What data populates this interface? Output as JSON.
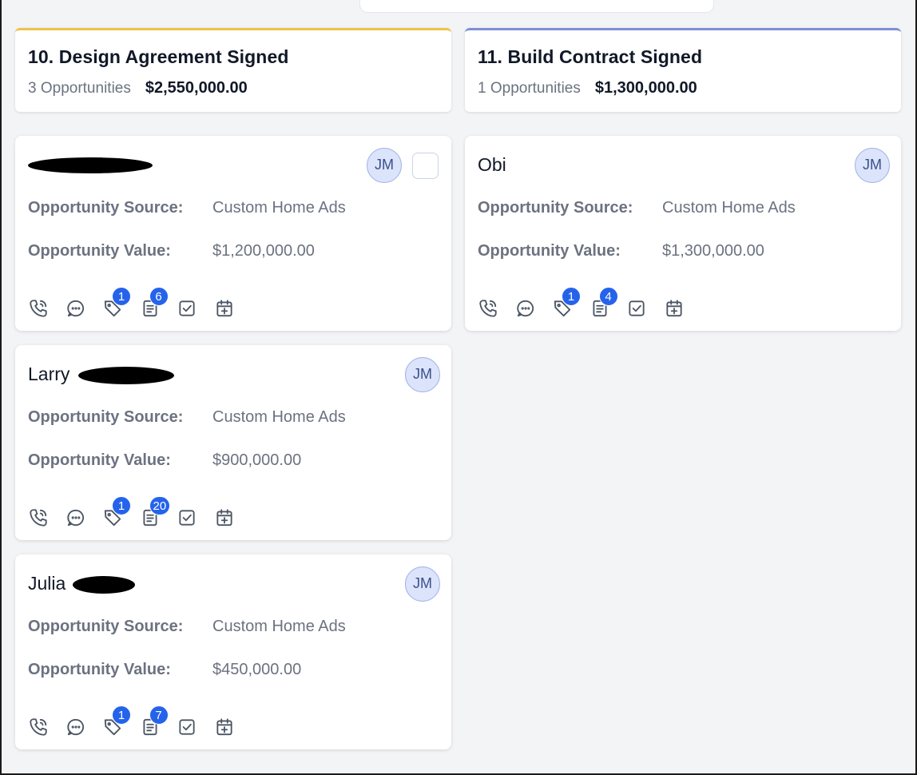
{
  "colors": {
    "col1_accent": "#f0c24b",
    "col2_accent": "#7e8fd6",
    "badge": "#2563eb"
  },
  "columns": [
    {
      "title": "10. Design Agreement Signed",
      "count": "3 Opportunities",
      "amount": "$2,550,000.00",
      "cards": [
        {
          "name": "",
          "avatar": "JM",
          "source_label": "Opportunity Source:",
          "source_value": "Custom Home Ads",
          "value_label": "Opportunity Value:",
          "value": "$1,200,000.00",
          "tags_badge": "1",
          "notes_badge": "6"
        },
        {
          "name": "Larry",
          "avatar": "JM",
          "source_label": "Opportunity Source:",
          "source_value": "Custom Home Ads",
          "value_label": "Opportunity Value:",
          "value": "$900,000.00",
          "tags_badge": "1",
          "notes_badge": "20"
        },
        {
          "name": "Julia",
          "avatar": "JM",
          "source_label": "Opportunity Source:",
          "source_value": "Custom Home Ads",
          "value_label": "Opportunity Value:",
          "value": "$450,000.00",
          "tags_badge": "1",
          "notes_badge": "7"
        }
      ]
    },
    {
      "title": "11. Build Contract Signed",
      "count": "1 Opportunities",
      "amount": "$1,300,000.00",
      "cards": [
        {
          "name": "Obi",
          "avatar": "JM",
          "source_label": "Opportunity Source:",
          "source_value": "Custom Home Ads",
          "value_label": "Opportunity Value:",
          "value": "$1,300,000.00",
          "tags_badge": "1",
          "notes_badge": "4"
        }
      ]
    }
  ],
  "icons": [
    "phone-icon",
    "chat-icon",
    "tag-icon",
    "notes-icon",
    "task-icon",
    "calendar-add-icon"
  ]
}
